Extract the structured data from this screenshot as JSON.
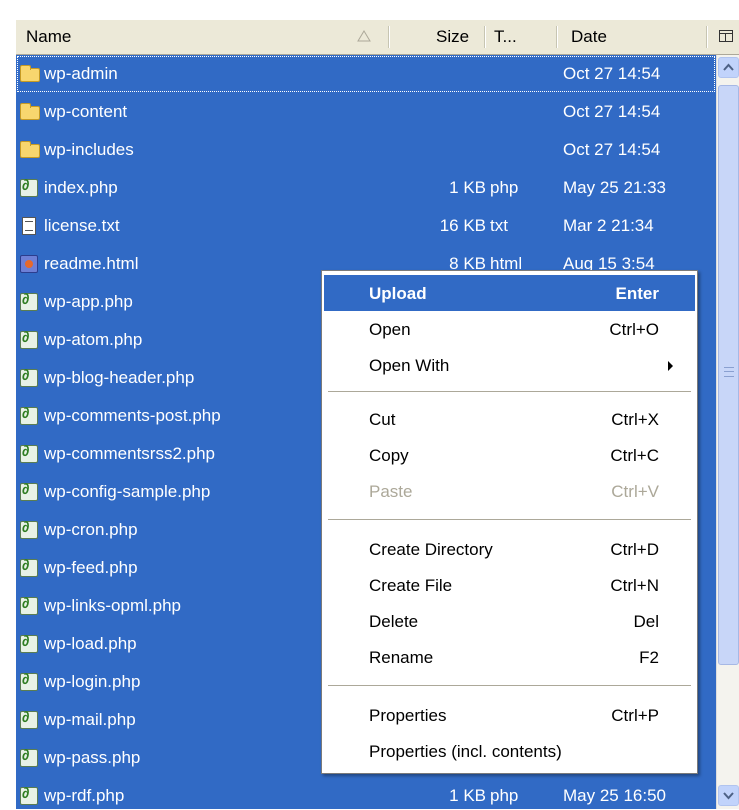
{
  "header": {
    "name": "Name",
    "size": "Size",
    "type": "T...",
    "date": "Date"
  },
  "files": [
    {
      "name": "wp-admin",
      "size": "",
      "type": "",
      "date": "Oct 27 14:54",
      "icon": "folder-icon"
    },
    {
      "name": "wp-content",
      "size": "",
      "type": "",
      "date": "Oct 27 14:54",
      "icon": "folder-icon"
    },
    {
      "name": "wp-includes",
      "size": "",
      "type": "",
      "date": "Oct 27 14:54",
      "icon": "folder-icon"
    },
    {
      "name": "index.php",
      "size": "1 KB",
      "type": "php",
      "date": "May 25 21:33",
      "icon": "php-file-icon"
    },
    {
      "name": "license.txt",
      "size": "16 KB",
      "type": "txt",
      "date": "Mar 2 21:34",
      "icon": "text-file-icon"
    },
    {
      "name": "readme.html",
      "size": "8 KB",
      "type": "html",
      "date": "Aug 15 3:54",
      "icon": "html-file-icon"
    },
    {
      "name": "wp-app.php",
      "size": "",
      "type": "",
      "date": "",
      "icon": "php-file-icon"
    },
    {
      "name": "wp-atom.php",
      "size": "",
      "type": "",
      "date": "",
      "icon": "php-file-icon"
    },
    {
      "name": "wp-blog-header.php",
      "size": "",
      "type": "",
      "date": "",
      "icon": "php-file-icon"
    },
    {
      "name": "wp-comments-post.php",
      "size": "",
      "type": "",
      "date": "",
      "icon": "php-file-icon"
    },
    {
      "name": "wp-commentsrss2.php",
      "size": "",
      "type": "",
      "date": "",
      "icon": "php-file-icon"
    },
    {
      "name": "wp-config-sample.php",
      "size": "",
      "type": "",
      "date": "",
      "icon": "php-file-icon"
    },
    {
      "name": "wp-cron.php",
      "size": "",
      "type": "",
      "date": "",
      "icon": "php-file-icon"
    },
    {
      "name": "wp-feed.php",
      "size": "",
      "type": "",
      "date": "",
      "icon": "php-file-icon"
    },
    {
      "name": "wp-links-opml.php",
      "size": "",
      "type": "",
      "date": "",
      "icon": "php-file-icon"
    },
    {
      "name": "wp-load.php",
      "size": "",
      "type": "",
      "date": "",
      "icon": "php-file-icon"
    },
    {
      "name": "wp-login.php",
      "size": "",
      "type": "",
      "date": "",
      "icon": "php-file-icon"
    },
    {
      "name": "wp-mail.php",
      "size": "",
      "type": "",
      "date": "",
      "icon": "php-file-icon"
    },
    {
      "name": "wp-pass.php",
      "size": "",
      "type": "",
      "date": "",
      "icon": "php-file-icon"
    },
    {
      "name": "wp-rdf.php",
      "size": "1 KB",
      "type": "php",
      "date": "May 25 16:50",
      "icon": "php-file-icon"
    }
  ],
  "menu": {
    "upload": {
      "label": "Upload",
      "shortcut": "Enter"
    },
    "open": {
      "label": "Open",
      "shortcut": "Ctrl+O"
    },
    "open_with": {
      "label": "Open With"
    },
    "cut": {
      "label": "Cut",
      "shortcut": "Ctrl+X"
    },
    "copy": {
      "label": "Copy",
      "shortcut": "Ctrl+C"
    },
    "paste": {
      "label": "Paste",
      "shortcut": "Ctrl+V"
    },
    "create_directory": {
      "label": "Create Directory",
      "shortcut": "Ctrl+D"
    },
    "create_file": {
      "label": "Create File",
      "shortcut": "Ctrl+N"
    },
    "delete": {
      "label": "Delete",
      "shortcut": "Del"
    },
    "rename": {
      "label": "Rename",
      "shortcut": "F2"
    },
    "properties": {
      "label": "Properties",
      "shortcut": "Ctrl+P"
    },
    "properties_incl": {
      "label": "Properties (incl. contents)"
    }
  },
  "colors": {
    "selection": "#316ac5",
    "header_bg": "#ece9d8",
    "disabled": "#aca899"
  }
}
